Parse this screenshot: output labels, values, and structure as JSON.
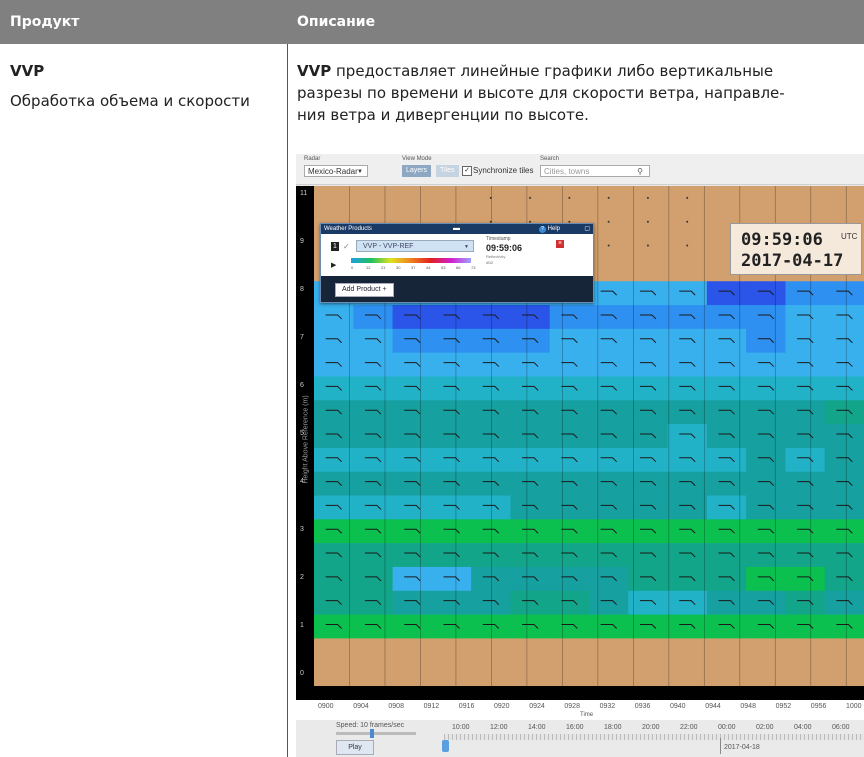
{
  "table": {
    "header_product": "Продукт",
    "header_description": "Описание"
  },
  "row": {
    "product_name": "VVP",
    "product_subtitle": "Обработка объема и скорости",
    "desc_bold": "VVP",
    "desc_line1": " предоставляет линейные графики либо вертикальные",
    "desc_line2": "разрезы по времени и высоте для скорости ветра, направле-",
    "desc_line3": "ния ветра и дивергенции по высоте."
  },
  "screenshot": {
    "toolbar": {
      "radar_label": "Radar",
      "radar_value": "Mexico-Radar",
      "view_mode_label": "View Mode",
      "layers_btn": "Layers",
      "tiles_btn": "Tiles",
      "sync_label": "Synchronize tiles",
      "search_label": "Search",
      "search_placeholder": "Cities, towns"
    },
    "panel": {
      "title": "Weather Products",
      "help": "Help",
      "layer_num": "1",
      "product_select": "VVP - VVP-REF",
      "timestamp_label": "Timestamp",
      "timestamp_value": "09:59:06",
      "scale_ticks": [
        "0",
        "12",
        "21",
        "30",
        "37",
        "44",
        "53",
        "66",
        "73"
      ],
      "reflectivity_label": "Reflectivity",
      "unit": "dBZ",
      "add_product": "Add Product +"
    },
    "timestamp_overlay": {
      "time": "09:59:06",
      "tz": "UTC",
      "date": "2017-04-17"
    },
    "y_axis": {
      "label": "Height Above Reference (m)",
      "ticks": [
        "11",
        "9",
        "8",
        "7",
        "6",
        "5",
        "4",
        "3",
        "2",
        "1",
        "0"
      ]
    },
    "x_axis": {
      "title": "Time",
      "ticks": [
        "0900",
        "0904",
        "0908",
        "0912",
        "0916",
        "0920",
        "0924",
        "0928",
        "0932",
        "0936",
        "0940",
        "0944",
        "0948",
        "0952",
        "0956",
        "1000"
      ]
    },
    "timeline": {
      "speed_label": "Speed: 10 frames/sec",
      "play_btn": "Play",
      "time_ticks": [
        "10:00",
        "12:00",
        "14:00",
        "16:00",
        "18:00",
        "20:00",
        "22:00",
        "00:00",
        "02:00",
        "04:00",
        "06:00"
      ],
      "date_label": "2017-04-18"
    },
    "colors": {
      "empty": "#d2a06e",
      "scale": [
        "#2a55e8",
        "#2e90f0",
        "#38b0ee",
        "#22b2c8",
        "#16a0a0",
        "#13a58a",
        "#0cc050",
        "#1fe01f"
      ]
    },
    "grid": [
      [
        0,
        0,
        0,
        0,
        0,
        0,
        0,
        0,
        0,
        0,
        0,
        0,
        0,
        0
      ],
      [
        0,
        0,
        0,
        0,
        0,
        0,
        0,
        0,
        0,
        0,
        0,
        0,
        0,
        0
      ],
      [
        0,
        0,
        0,
        0,
        0,
        0,
        0,
        0,
        0,
        0,
        0,
        0,
        0,
        0
      ],
      [
        0,
        0,
        0,
        0,
        0,
        0,
        0,
        0,
        0,
        0,
        0,
        0,
        0,
        0
      ],
      [
        3,
        3,
        3,
        3,
        3,
        3,
        3,
        3,
        3,
        3,
        1,
        1,
        2,
        2
      ],
      [
        3,
        2,
        1,
        1,
        1,
        1,
        2,
        2,
        2,
        2,
        2,
        2,
        3,
        3
      ],
      [
        3,
        3,
        2,
        2,
        2,
        2,
        3,
        3,
        3,
        3,
        3,
        2,
        3,
        3
      ],
      [
        3,
        3,
        3,
        3,
        3,
        3,
        3,
        3,
        3,
        3,
        3,
        3,
        3,
        3
      ],
      [
        4,
        4,
        4,
        4,
        4,
        4,
        4,
        4,
        4,
        4,
        4,
        4,
        4,
        4
      ],
      [
        5,
        5,
        5,
        5,
        5,
        5,
        5,
        5,
        5,
        5,
        5,
        5,
        5,
        6
      ],
      [
        5,
        5,
        5,
        5,
        5,
        5,
        5,
        5,
        5,
        4,
        5,
        5,
        5,
        5
      ],
      [
        4,
        4,
        4,
        4,
        4,
        4,
        4,
        4,
        4,
        4,
        4,
        5,
        4,
        5
      ],
      [
        5,
        5,
        5,
        5,
        5,
        5,
        5,
        5,
        5,
        5,
        5,
        5,
        5,
        5
      ],
      [
        4,
        4,
        4,
        4,
        4,
        5,
        5,
        5,
        5,
        5,
        4,
        5,
        5,
        5
      ],
      [
        7,
        7,
        7,
        7,
        7,
        7,
        7,
        7,
        7,
        7,
        7,
        7,
        7,
        7
      ],
      [
        6,
        6,
        6,
        6,
        6,
        6,
        6,
        6,
        6,
        6,
        6,
        6,
        6,
        6
      ],
      [
        6,
        6,
        3,
        3,
        5,
        5,
        5,
        5,
        6,
        6,
        6,
        7,
        7,
        6
      ],
      [
        6,
        6,
        5,
        5,
        5,
        6,
        6,
        5,
        4,
        4,
        5,
        5,
        6,
        5
      ],
      [
        7,
        7,
        7,
        7,
        7,
        7,
        7,
        7,
        7,
        7,
        7,
        7,
        7,
        7
      ],
      [
        0,
        0,
        0,
        0,
        0,
        0,
        0,
        0,
        0,
        0,
        0,
        0,
        0,
        0
      ],
      [
        0,
        0,
        0,
        0,
        0,
        0,
        0,
        0,
        0,
        0,
        0,
        0,
        0,
        0
      ]
    ]
  }
}
